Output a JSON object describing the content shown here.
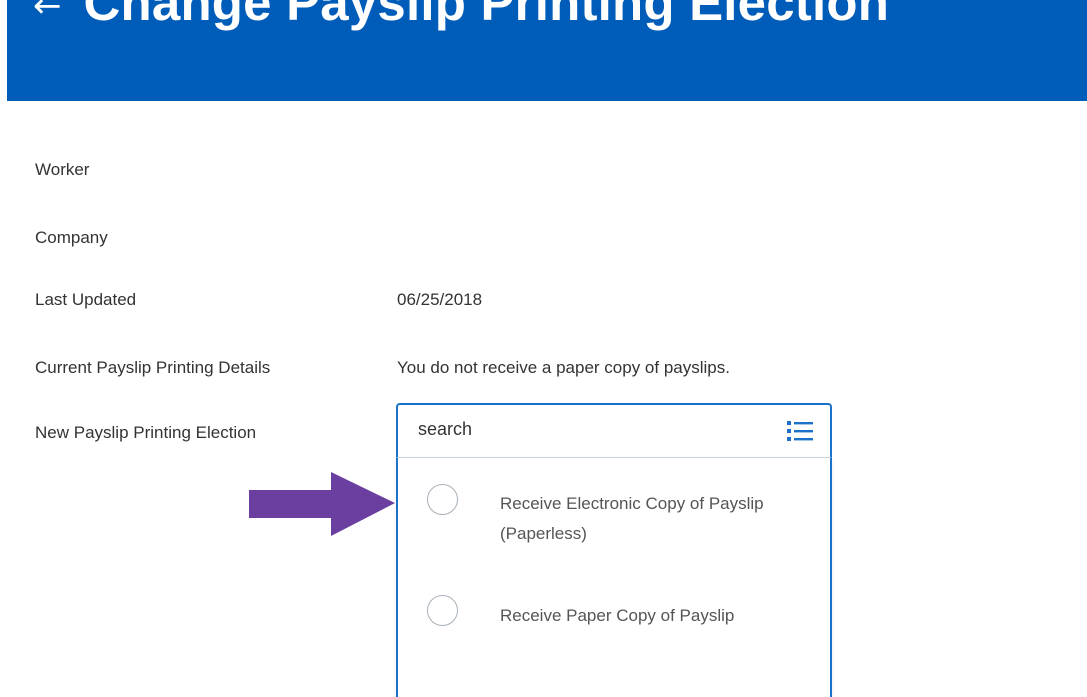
{
  "header": {
    "back_icon": "arrow-left-icon",
    "title": "Change Payslip Printing Election",
    "background_color": "#005cb9"
  },
  "fields": {
    "worker": {
      "label": "Worker",
      "value": ""
    },
    "company": {
      "label": "Company",
      "value": ""
    },
    "last_updated": {
      "label": "Last Updated",
      "value": "06/25/2018"
    },
    "current_details": {
      "label": "Current Payslip Printing Details",
      "value": "You do not receive a paper copy of payslips."
    },
    "new_election": {
      "label": "New Payslip Printing Election"
    }
  },
  "search": {
    "placeholder": "search",
    "value": "",
    "icon": "list-icon",
    "border_color": "#1a73c8"
  },
  "options": [
    {
      "label": "Receive Electronic Copy of Payslip (Paperless)",
      "selected": false
    },
    {
      "label": "Receive Paper Copy of Payslip",
      "selected": false
    }
  ],
  "annotation": {
    "icon": "arrow-right-icon",
    "color": "#6a3fa0"
  }
}
